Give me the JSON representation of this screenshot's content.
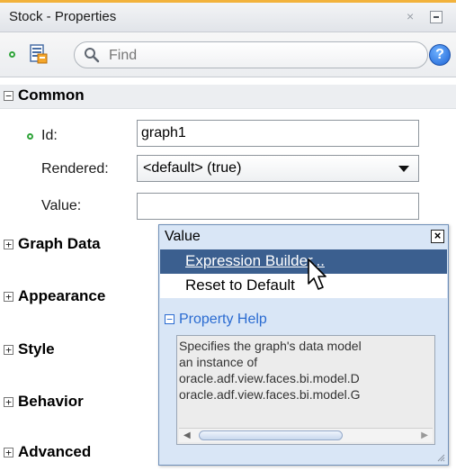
{
  "panel": {
    "title": "Stock - Properties",
    "close_glyph": "×"
  },
  "toolbar": {
    "search_placeholder": "Find",
    "help_glyph": "?"
  },
  "sections": {
    "common": {
      "toggle": "−",
      "label": "Common"
    },
    "graph_data": {
      "toggle": "+",
      "label": "Graph Data"
    },
    "appearance": {
      "toggle": "+",
      "label": "Appearance"
    },
    "style": {
      "toggle": "+",
      "label": "Style"
    },
    "behavior": {
      "toggle": "+",
      "label": "Behavior"
    },
    "advanced": {
      "toggle": "+",
      "label": "Advanced"
    }
  },
  "fields": {
    "id_label": "Id:",
    "id_value": "graph1",
    "rendered_label": "Rendered:",
    "rendered_value": "<default> (true)",
    "value_label": "Value:",
    "value_value": ""
  },
  "popup": {
    "title": "Value",
    "close_glyph": "×",
    "menu": {
      "expression_builder": "Expression Builder...",
      "reset_to_default": "Reset to Default"
    },
    "property_help": {
      "toggle": "−",
      "label": "Property Help",
      "lines": [
        "Specifies the graph's data model",
        "an instance of",
        "oracle.adf.view.faces.bi.model.D",
        "oracle.adf.view.faces.bi.model.G"
      ]
    }
  },
  "colors": {
    "title_accent": "#f2b23c",
    "selection": "#3b5f8f",
    "popup_bg": "#d9e6f6",
    "help_link": "#2a6bd1",
    "required_dot": "#2fa43a"
  },
  "icons": [
    "required-dot-icon",
    "property-inspector-icon",
    "search-icon",
    "help-icon",
    "close-icon",
    "expand-icon",
    "collapse-icon",
    "dropdown-arrow-icon",
    "cursor-icon",
    "resize-grip-icon"
  ]
}
